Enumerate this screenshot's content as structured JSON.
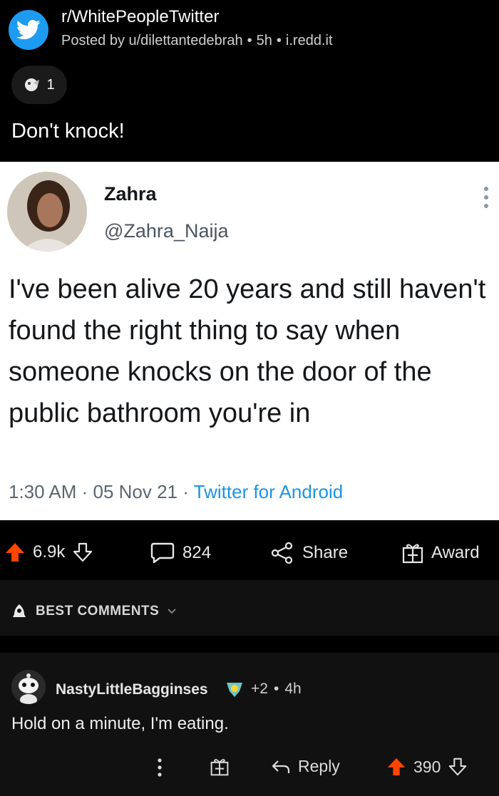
{
  "header": {
    "subreddit": "r/WhitePeopleTwitter",
    "posted_by": "Posted by u/dilettantedebrah",
    "age": "5h",
    "domain": "i.redd.it",
    "award_count": "1",
    "title": "Don't knock!"
  },
  "tweet": {
    "name": "Zahra",
    "handle": "@Zahra_Naija",
    "text": "I've been alive 20 years and still haven't found the right thing to say when someone knocks on the door of the public bathroom you're in",
    "time": "1:30 AM · 05 Nov 21 · ",
    "source": "Twitter for Android"
  },
  "actions": {
    "votes": "6.9k",
    "comments": "824",
    "share": "Share",
    "award": "Award",
    "accent": "#ff4500"
  },
  "sort": {
    "label": "BEST COMMENTS"
  },
  "comment": {
    "user": "NastyLittleBagginses",
    "award_plus": "+2",
    "age": "4h",
    "body": "Hold on a minute, I'm eating.",
    "reply": "Reply",
    "votes": "390"
  },
  "colors": {
    "twitter_blue": "#1d9bf0",
    "upvote_orange": "#ff4500"
  }
}
